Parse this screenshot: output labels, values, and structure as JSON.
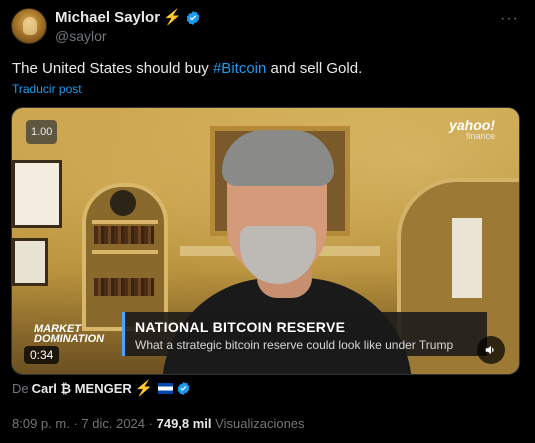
{
  "author": {
    "name": "Michael Saylor",
    "name_emoji": "⚡",
    "handle": "@saylor",
    "verified_color": "#1d9bf0"
  },
  "menu": {
    "more_label": "···"
  },
  "tweet": {
    "text_before": "The United States should buy ",
    "hashtag": "#Bitcoin",
    "text_after": " and sell Gold.",
    "translate_label": "Traducir post"
  },
  "video": {
    "speed": "1.00",
    "brand_name": "yahoo!",
    "brand_sub": "finance",
    "show_name_line1": "MARKET",
    "show_name_line2": "DOMINATION",
    "headline": "NATIONAL BITCOIN RESERVE",
    "subheadline": "What a strategic bitcoin reserve could look like under Trump",
    "timestamp": "0:34",
    "icons": {
      "mute": "speaker-icon"
    }
  },
  "attribution": {
    "prefix": "De",
    "name": "Carl ₿ MENGER",
    "emoji": "⚡"
  },
  "meta": {
    "time": "8:09 p. m.",
    "sep1": "·",
    "date": "7 dic. 2024",
    "sep2": "·",
    "views_count": "749,8 mil",
    "views_label": "Visualizaciones"
  }
}
